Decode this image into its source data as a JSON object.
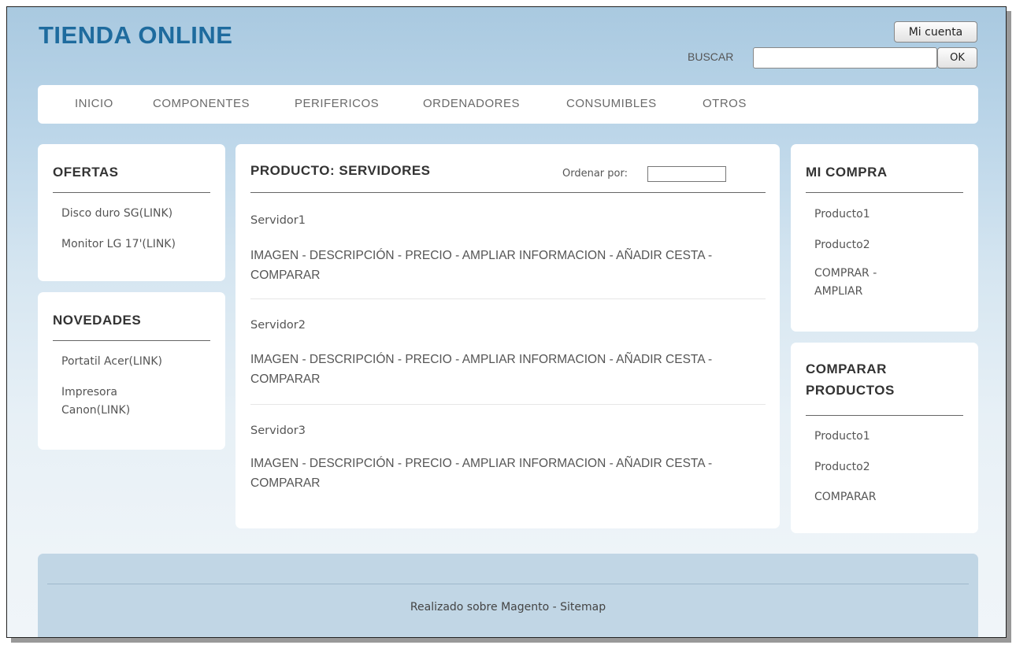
{
  "header": {
    "logo": "TIENDA ONLINE",
    "account_button": "Mi cuenta",
    "search_label": "BUSCAR",
    "search_button": "OK"
  },
  "nav": [
    "INICIO",
    "COMPONENTES",
    "PERIFERICOS",
    "ORDENADORES",
    "CONSUMIBLES",
    "OTROS"
  ],
  "ofertas": {
    "title": "OFERTAS",
    "items": [
      "Disco duro SG(LINK)",
      "Monitor LG 17'(LINK)"
    ]
  },
  "novedades": {
    "title": "NOVEDADES",
    "items": [
      "Portatil Acer(LINK)",
      "Impresora Canon(LINK)"
    ]
  },
  "main": {
    "title": "PRODUCTO: SERVIDORES",
    "sort_label": "Ordenar por:",
    "products": [
      {
        "name": "Servidor1",
        "details": "IMAGEN - DESCRIPCIÓN - PRECIO - AMPLIAR INFORMACION - AÑADIR CESTA - COMPARAR"
      },
      {
        "name": "Servidor2",
        "details": "IMAGEN - DESCRIPCIÓN - PRECIO - AMPLIAR INFORMACION - AÑADIR CESTA - COMPARAR"
      },
      {
        "name": "Servidor3",
        "details": "IMAGEN - DESCRIPCIÓN - PRECIO - AMPLIAR INFORMACION - AÑADIR CESTA - COMPARAR"
      }
    ]
  },
  "mi_compra": {
    "title": "MI COMPRA",
    "items": [
      "Producto1",
      "Producto2"
    ],
    "action": "COMPRAR - AMPLIAR"
  },
  "comparar": {
    "title": "COMPARAR PRODUCTOS",
    "items": [
      "Producto1",
      "Producto2"
    ],
    "action": "COMPARAR"
  },
  "footer": {
    "text": "Realizado sobre Magento - Sitemap"
  },
  "colors": {
    "logo": "#1e6b9e",
    "background_top": "#a9c9e0",
    "background_bottom": "#f0f5f9",
    "footer": "#c1d6e5"
  }
}
